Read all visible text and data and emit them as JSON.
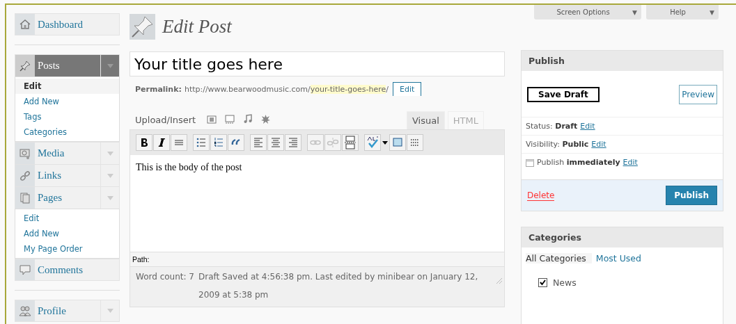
{
  "top_bar": {
    "buttons": [
      {
        "label": "Screen Options",
        "arrow": "▼"
      },
      {
        "label": "Help",
        "arrow": "▼"
      }
    ]
  },
  "sidebar": {
    "groups": [
      [
        {
          "label": "Dashboard",
          "selected": false,
          "toggle": false
        }
      ],
      [
        {
          "label": "Posts",
          "selected": true,
          "toggle": true,
          "children": [
            {
              "label": "Edit",
              "selected": true
            },
            {
              "label": "Add New",
              "selected": false
            },
            {
              "label": "Tags",
              "selected": false
            },
            {
              "label": "Categories",
              "selected": false
            }
          ]
        },
        {
          "label": "Media",
          "selected": false,
          "toggle": true
        },
        {
          "label": "Links",
          "selected": false,
          "toggle": true
        },
        {
          "label": "Pages",
          "selected": false,
          "toggle": true,
          "children": [
            {
              "label": "Edit",
              "selected": false
            },
            {
              "label": "Add New",
              "selected": false
            },
            {
              "label": "My Page Order",
              "selected": false
            }
          ]
        },
        {
          "label": "Comments",
          "selected": false,
          "toggle": false
        }
      ],
      [
        {
          "label": "Profile",
          "selected": false,
          "toggle": true
        }
      ]
    ]
  },
  "page": {
    "title": "Edit Post"
  },
  "post": {
    "title": "Your title goes here",
    "permalink": {
      "label": "Permalink:",
      "base": "http://www.bearwoodmusic.com/",
      "slug": "your-title-goes-here",
      "trail": "/",
      "edit": "Edit"
    },
    "upload_label": "Upload/Insert",
    "editor_tabs": [
      {
        "label": "Visual",
        "selected": true
      },
      {
        "label": "HTML",
        "selected": false
      }
    ],
    "toolbar": [
      {
        "disabled": false
      },
      {
        "disabled": false
      },
      {
        "disabled": false
      },
      {
        "disabled": false
      },
      {
        "disabled": false
      },
      {
        "disabled": false
      },
      {
        "disabled": false
      },
      {
        "disabled": false
      },
      {
        "disabled": false
      },
      {
        "disabled": true
      },
      {
        "disabled": true
      },
      {
        "disabled": false
      },
      {
        "disabled": false
      },
      {
        "disabled": false
      },
      {
        "disabled": false
      }
    ],
    "body": "This is the body of the post",
    "path": "Path:",
    "word_count": "Word count: 7",
    "draft_note": "Draft Saved at 4:56:38 pm. Last edited by minibear on January 12, 2009 at 5:38 pm"
  },
  "publish": {
    "title": "Publish",
    "save_draft": "Save Draft",
    "preview": "Preview",
    "rows": [
      {
        "label": "Status:",
        "value": "Draft",
        "edit": "Edit"
      },
      {
        "label": "Visibility:",
        "value": "Public",
        "edit": "Edit"
      },
      {
        "label": "Publish",
        "value": "immediately",
        "edit": "Edit"
      }
    ],
    "delete": "Delete",
    "publish_button": "Publish"
  },
  "categories": {
    "title": "Categories",
    "tabs": [
      {
        "label": "All Categories",
        "selected": true
      },
      {
        "label": "Most Used",
        "selected": false
      }
    ],
    "items": [
      {
        "label": "News",
        "checked": true
      }
    ]
  }
}
